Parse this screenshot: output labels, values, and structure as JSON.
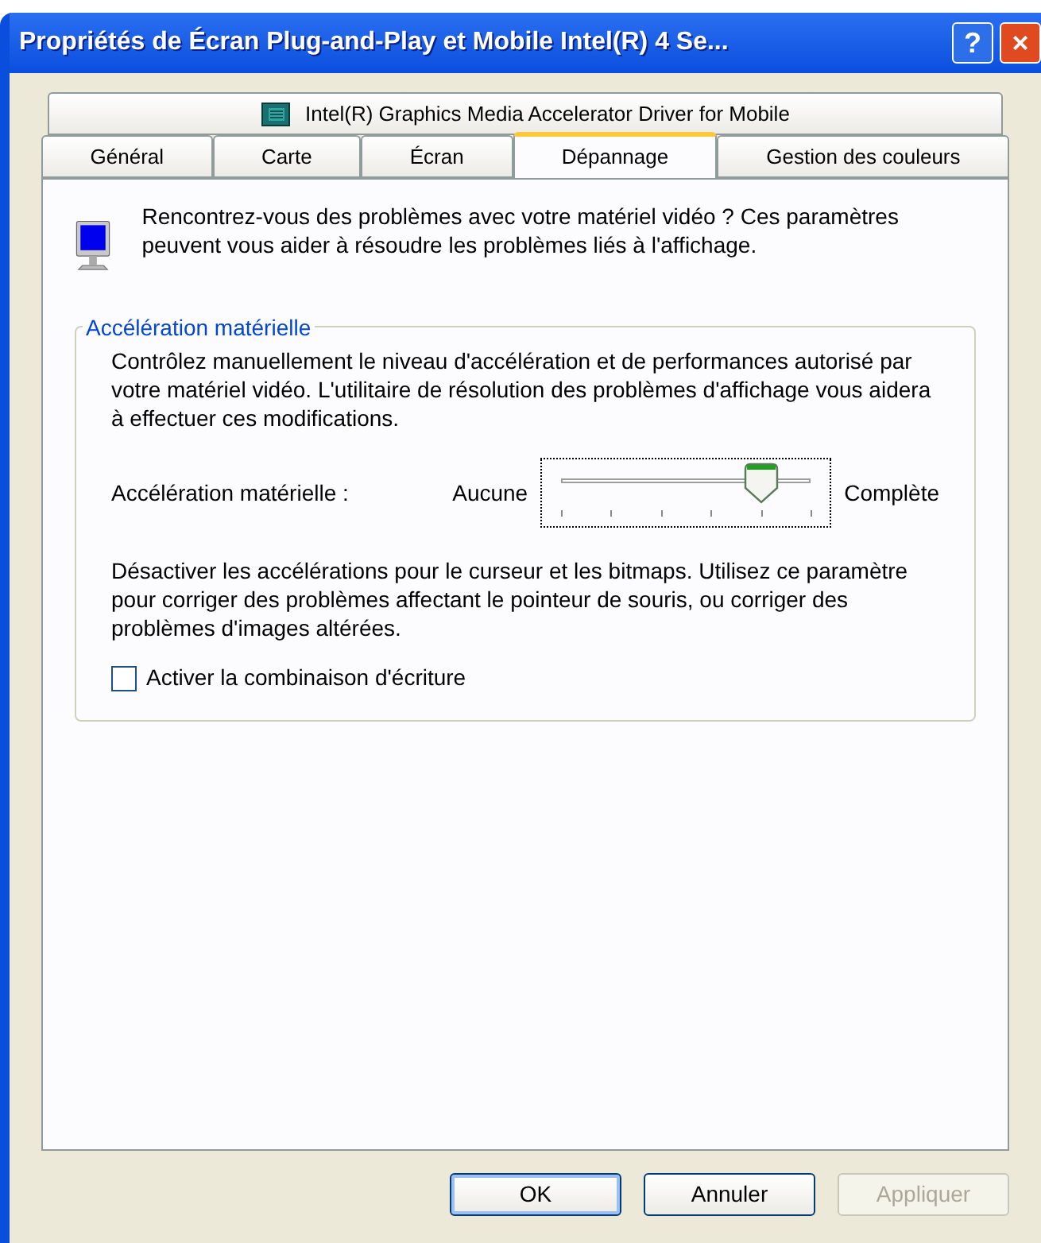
{
  "window": {
    "title": "Propriétés de Écran Plug-and-Play et Mobile Intel(R) 4 Se..."
  },
  "title_buttons": [
    {
      "kind": "help",
      "label": "?"
    },
    {
      "kind": "close",
      "label": "×"
    }
  ],
  "tab_rows": [
    [
      {
        "label": "Intel(R) Graphics Media Accelerator Driver for Mobile",
        "selected": false,
        "icon": true
      }
    ],
    [
      {
        "label": "Général",
        "selected": false
      },
      {
        "label": "Carte",
        "selected": false
      },
      {
        "label": "Écran",
        "selected": false
      },
      {
        "label": "Dépannage",
        "selected": true
      },
      {
        "label": "Gestion des couleurs",
        "selected": false
      }
    ]
  ],
  "intro": "Rencontrez-vous des problèmes avec votre matériel vidéo ? Ces paramètres peuvent vous aider à résoudre les problèmes liés à l'affichage.",
  "group": {
    "title": "Accélération matérielle",
    "description": "Contrôlez manuellement le niveau d'accélération et de performances autorisé par votre matériel vidéo. L'utilitaire de résolution des problèmes d'affichage vous aidera à effectuer ces modifications.",
    "slider": {
      "label": "Accélération matérielle :",
      "min_label": "Aucune",
      "max_label": "Complète",
      "level": 0.8
    },
    "note": "Désactiver les accélérations pour le curseur et les bitmaps. Utilisez ce paramètre pour corriger des problèmes affectant le pointeur de souris, ou corriger des problèmes d'images altérées.",
    "checkbox": {
      "label": "Activer la combinaison d'écriture",
      "checked": false
    }
  },
  "buttons": [
    {
      "label": "OK",
      "disabled": false,
      "default": true
    },
    {
      "label": "Annuler",
      "disabled": false,
      "default": false
    },
    {
      "label": "Appliquer",
      "disabled": true,
      "default": false
    }
  ]
}
